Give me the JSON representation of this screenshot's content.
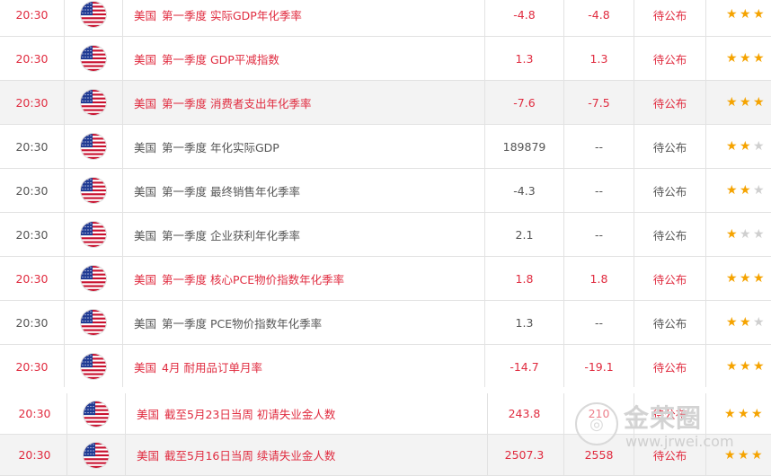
{
  "rows": [
    {
      "time": "20:30",
      "country": "美国",
      "event": "第一季度 实际GDP年化季率",
      "previous": "-4.8",
      "forecast": "-4.8",
      "actual": "待公布",
      "stars": 3,
      "color": "red",
      "shade": false
    },
    {
      "time": "20:30",
      "country": "美国",
      "event": "第一季度 GDP平减指数",
      "previous": "1.3",
      "forecast": "1.3",
      "actual": "待公布",
      "stars": 3,
      "color": "red",
      "shade": false
    },
    {
      "time": "20:30",
      "country": "美国",
      "event": "第一季度 消费者支出年化季率",
      "previous": "-7.6",
      "forecast": "-7.5",
      "actual": "待公布",
      "stars": 3,
      "color": "red",
      "shade": true
    },
    {
      "time": "20:30",
      "country": "美国",
      "event": "第一季度 年化实际GDP",
      "previous": "189879",
      "forecast": "--",
      "actual": "待公布",
      "stars": 2,
      "color": "gray",
      "shade": false
    },
    {
      "time": "20:30",
      "country": "美国",
      "event": "第一季度 最终销售年化季率",
      "previous": "-4.3",
      "forecast": "--",
      "actual": "待公布",
      "stars": 2,
      "color": "gray",
      "shade": false
    },
    {
      "time": "20:30",
      "country": "美国",
      "event": "第一季度 企业获利年化季率",
      "previous": "2.1",
      "forecast": "--",
      "actual": "待公布",
      "stars": 1,
      "color": "gray",
      "shade": false
    },
    {
      "time": "20:30",
      "country": "美国",
      "event": "第一季度 核心PCE物价指数年化季率",
      "previous": "1.8",
      "forecast": "1.8",
      "actual": "待公布",
      "stars": 3,
      "color": "red",
      "shade": false
    },
    {
      "time": "20:30",
      "country": "美国",
      "event": "第一季度 PCE物价指数年化季率",
      "previous": "1.3",
      "forecast": "--",
      "actual": "待公布",
      "stars": 2,
      "color": "gray",
      "shade": false
    },
    {
      "time": "20:30",
      "country": "美国",
      "event": "4月 耐用品订单月率",
      "previous": "-14.7",
      "forecast": "-19.1",
      "actual": "待公布",
      "stars": 3,
      "color": "red",
      "shade": false
    },
    {
      "time": "20:30",
      "country": "美国",
      "event": "截至5月23日当周 初请失业金人数",
      "previous": "243.8",
      "forecast": "210",
      "actual": "待公布",
      "stars": 3,
      "color": "red",
      "shade": false
    },
    {
      "time": "20:30",
      "country": "美国",
      "event": "截至5月16日当周 续请失业金人数",
      "previous": "2507.3",
      "forecast": "2558",
      "actual": "待公布",
      "stars": 3,
      "color": "red",
      "shade": true
    }
  ],
  "watermark": {
    "brand": "金荣圈",
    "url": "www.jrwei.com"
  },
  "colors": {
    "red": "#e02b3f",
    "gray": "#555555",
    "star": "#f5a300",
    "star_off": "#cfcfcf"
  }
}
